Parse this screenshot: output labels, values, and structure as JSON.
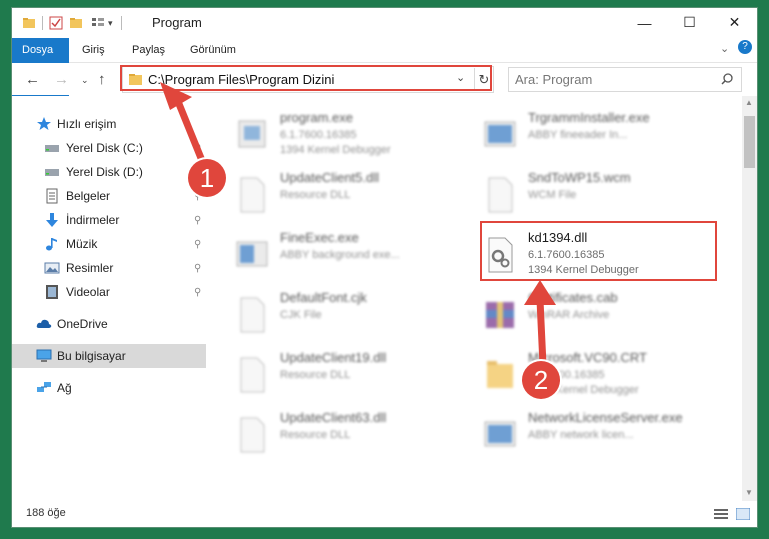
{
  "window": {
    "title": "Program",
    "controls": {
      "minimize": "—",
      "maximize": "☐",
      "close": "✕"
    }
  },
  "ribbon": {
    "tabs": [
      "Dosya",
      "Giriş",
      "Paylaş",
      "Görünüm"
    ],
    "help_icon": "?"
  },
  "navigation": {
    "address": "C:\\Program Files\\Program Dizini",
    "search_placeholder": "Ara: Program"
  },
  "sidebar": {
    "items": [
      {
        "label": "Hızlı erişim",
        "icon": "star-icon"
      },
      {
        "label": "Yerel Disk (C:)",
        "icon": "drive-icon"
      },
      {
        "label": "Yerel Disk (D:)",
        "icon": "drive-icon"
      },
      {
        "label": "Belgeler",
        "icon": "documents-icon"
      },
      {
        "label": "İndirmeler",
        "icon": "download-icon"
      },
      {
        "label": "Müzik",
        "icon": "music-icon"
      },
      {
        "label": "Resimler",
        "icon": "pictures-icon"
      },
      {
        "label": "Videolar",
        "icon": "videos-icon"
      },
      {
        "label": "OneDrive",
        "icon": "cloud-icon"
      },
      {
        "label": "Bu bilgisayar",
        "icon": "computer-icon"
      },
      {
        "label": "Ağ",
        "icon": "network-icon"
      }
    ]
  },
  "files": [
    {
      "name": "program.exe",
      "line1": "6.1.7600.16385",
      "line2": "1394 Kernel Debugger"
    },
    {
      "name": "TrgrammInstaller.exe",
      "line1": "ABBY fineeader In...",
      "line2": ""
    },
    {
      "name": "UpdateClient5.dll",
      "line1": "Resource DLL",
      "line2": ""
    },
    {
      "name": "SndToWP15.wcm",
      "line1": "WCM File",
      "line2": ""
    },
    {
      "name": "FineExec.exe",
      "line1": "ABBY background exe...",
      "line2": ""
    },
    {
      "name": "kd1394.dll",
      "line1": "6.1.7600.16385",
      "line2": "1394 Kernel Debugger"
    },
    {
      "name": "DefaultFont.cjk",
      "line1": "CJK File",
      "line2": ""
    },
    {
      "name": "Certificates.cab",
      "line1": "WinRAR Archive",
      "line2": ""
    },
    {
      "name": "UpdateClient19.dll",
      "line1": "Resource DLL",
      "line2": ""
    },
    {
      "name": "Microsoft.VC90.CRT",
      "line1": "6.1.7600.16385",
      "line2": "1394 Kernel Debugger"
    },
    {
      "name": "UpdateClient63.dll",
      "line1": "Resource DLL",
      "line2": ""
    },
    {
      "name": "NetworkLicenseServer.exe",
      "line1": "ABBY network licen...",
      "line2": ""
    }
  ],
  "status": {
    "count": "188 öğe"
  },
  "annotations": {
    "badge1": "1",
    "badge2": "2"
  },
  "colors": {
    "accent": "#1979ca",
    "highlight": "#e0463c",
    "background": "#1f7a4d"
  }
}
